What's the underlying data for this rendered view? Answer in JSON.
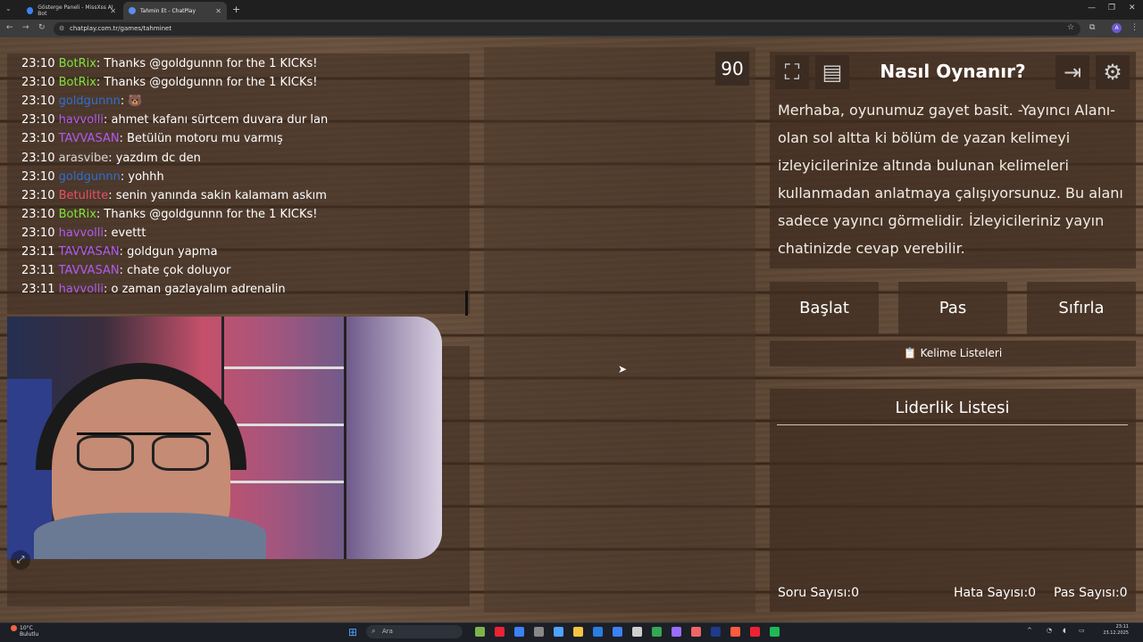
{
  "browser": {
    "tabs": [
      {
        "title": "Gösterge Paneli - MissXss AI Bot",
        "active": false
      },
      {
        "title": "Tahmin Et - ChatPlay",
        "active": true
      }
    ],
    "url": "chatplay.com.tr/games/tahminet"
  },
  "chat": {
    "messages": [
      {
        "time": "23:10",
        "user": "BotRix",
        "color": "#7fe33b",
        "text": ": Thanks @goldgunnn for the 1 KICKs!"
      },
      {
        "time": "23:10",
        "user": "BotRix",
        "color": "#7fe33b",
        "text": ": Thanks @goldgunnn for the 1 KICKs!"
      },
      {
        "time": "23:10",
        "user": "goldgunnn",
        "color": "#2f6fd1",
        "text": ": 🐻"
      },
      {
        "time": "23:10",
        "user": "havvolli",
        "color": "#b15bf0",
        "text": ": ahmet kafanı sürtcem duvara dur lan"
      },
      {
        "time": "23:10",
        "user": "TAVVASAN",
        "color": "#b15bf0",
        "text": ": Betülün motoru mu varmış"
      },
      {
        "time": "23:10",
        "user": "arasvibe",
        "color": "#d8d8d8",
        "text": ": yazdım dc den"
      },
      {
        "time": "23:10",
        "user": "goldgunnn",
        "color": "#2f6fd1",
        "text": ": yohhh"
      },
      {
        "time": "23:10",
        "user": "Betulitte",
        "color": "#e8506a",
        "text": ": senin yanında sakin kalamam askım"
      },
      {
        "time": "23:10",
        "user": "BotRix",
        "color": "#7fe33b",
        "text": ": Thanks @goldgunnn for the 1 KICKs!"
      },
      {
        "time": "23:10",
        "user": "havvolli",
        "color": "#b15bf0",
        "text": ": evettt"
      },
      {
        "time": "23:11",
        "user": "TAVVASAN",
        "color": "#b15bf0",
        "text": ": goldgun yapma"
      },
      {
        "time": "23:11",
        "user": "TAVVASAN",
        "color": "#b15bf0",
        "text": ": chate çok doluyor"
      },
      {
        "time": "23:11",
        "user": "havvolli",
        "color": "#b15bf0",
        "text": ": o zaman gazlayalım adrenalin"
      }
    ]
  },
  "game": {
    "timer": "90"
  },
  "howto": {
    "title": "Nasıl Oynanır?",
    "text": "Merhaba, oyunumuz gayet basit. -Yayıncı Alanı- olan sol altta ki bölüm de yazan kelimeyi izleyicilerinize altında bulunan kelimeleri kullanmadan anlatmaya çalışıyorsunuz. Bu alanı sadece yayıncı görmelidir. İzleyicileriniz yayın chatinizde cevap verebilir."
  },
  "controls": {
    "start": "Başlat",
    "pass": "Pas",
    "reset": "Sıfırla",
    "word_lists": "📋 Kelime Listeleri"
  },
  "leaderboard": {
    "title": "Liderlik Listesi"
  },
  "stats": {
    "questions": "Soru Sayısı:0",
    "errors": "Hata Sayısı:0",
    "passes": "Pas Sayısı:0"
  },
  "taskbar": {
    "weather_temp": "10°C",
    "weather_desc": "Bulutlu",
    "search_placeholder": "Ara",
    "time": "23:11",
    "date": "23.12.2025"
  }
}
